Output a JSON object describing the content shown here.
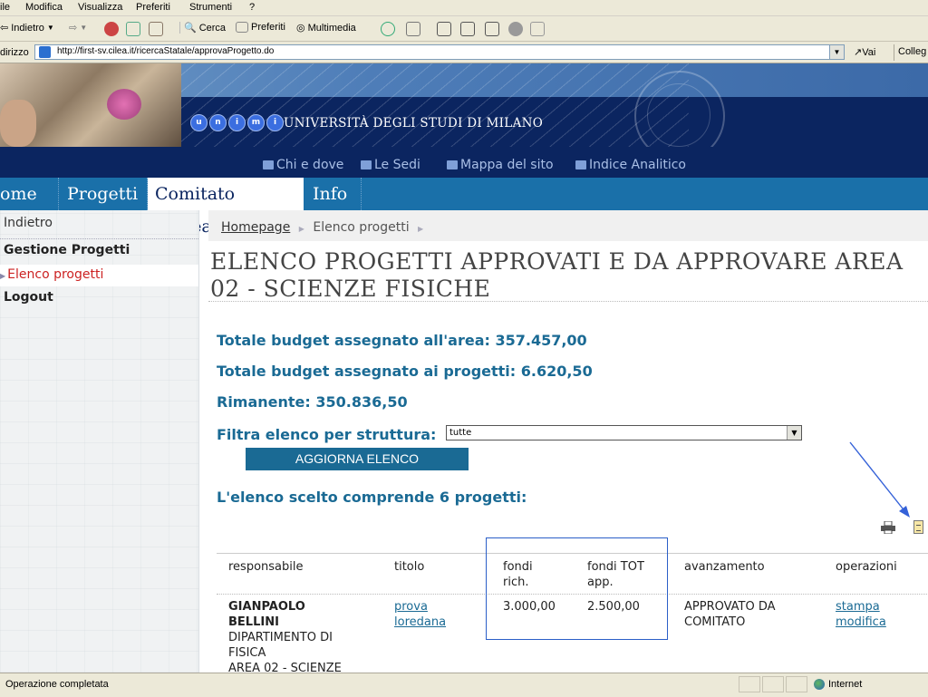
{
  "browser": {
    "menu": [
      "ile",
      "Modifica",
      "Visualizza",
      "Preferiti",
      "Strumenti",
      "?"
    ],
    "toolbar": {
      "back": "Indietro",
      "search": "Cerca",
      "favorites": "Preferiti",
      "media": "Multimedia"
    },
    "address_label": "dirizzo",
    "url": "http://first-sv.cilea.it/ricercaStatale/approvaProgetto.do",
    "go": "Vai",
    "links": "Colleg"
  },
  "site": {
    "logo_letters": [
      "u",
      "n",
      "i",
      "m",
      "i"
    ],
    "university": "UNIVERSITÀ DEGLI STUDI DI MILANO",
    "services": [
      "Chi e dove",
      "Le Sedi",
      "Mappa del sito",
      "Indice Analitico"
    ],
    "nav": [
      "ome",
      "Progetti",
      "Comitato d'Area",
      "Info"
    ]
  },
  "sidebar": {
    "back": "Indietro",
    "group": "Gestione Progetti",
    "current": "Elenco progetti",
    "logout": "Logout"
  },
  "breadcrumb": [
    "Homepage",
    "Elenco progetti"
  ],
  "page": {
    "title_line1": "ELENCO PROGETTI APPROVATI E DA APPROVARE AREA",
    "title_line2": "02 - SCIENZE FISICHE",
    "budget_area": "Totale budget assegnato all'area: 357.457,00",
    "budget_projects": "Totale budget assegnato ai progetti: 6.620,50",
    "remaining": "Rimanente: 350.836,50",
    "filter_label": "Filtra elenco per struttura:",
    "filter_value": "tutte",
    "update_button": "AGGIORNA ELENCO",
    "count_text": "L'elenco scelto comprende 6 progetti:"
  },
  "table": {
    "headers": [
      "responsabile",
      "titolo",
      "fondi\nrich.",
      "fondi TOT\napp.",
      "avanzamento",
      "operazioni"
    ],
    "row": {
      "name": "GIANPAOLO\nBELLINI",
      "dept": "DIPARTIMENTO DI\nFISICA\nAREA 02 - SCIENZE",
      "title": "prova\nloredana",
      "requested": "3.000,00",
      "approved": "2.500,00",
      "status": "APPROVATO DA\nCOMITATO",
      "op_print": "stampa",
      "op_edit": "modifica"
    }
  },
  "status": {
    "text": "Operazione completata",
    "zone": "Internet"
  }
}
